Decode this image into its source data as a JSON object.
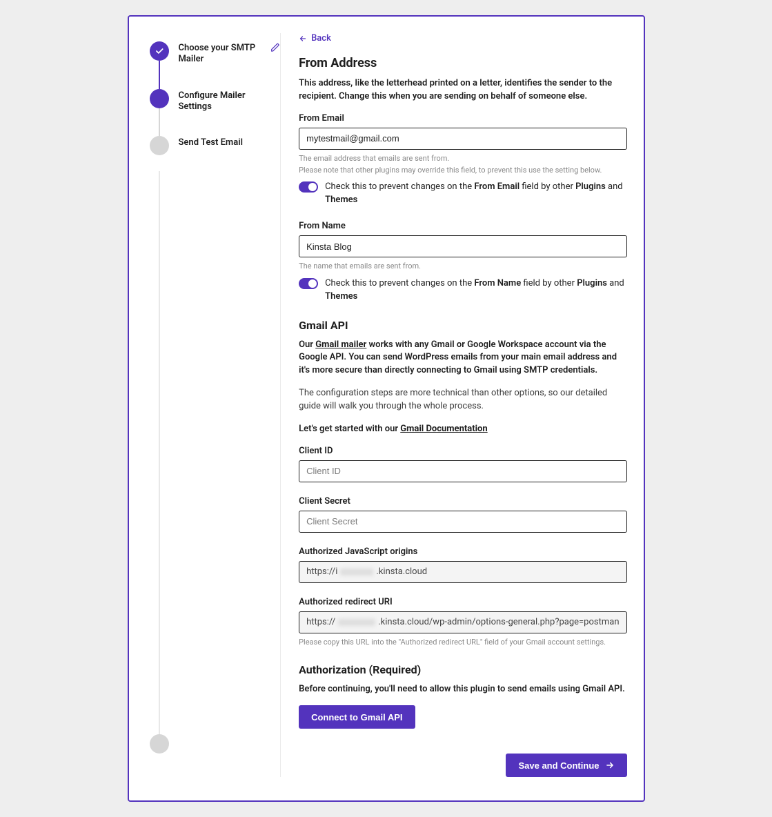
{
  "stepper": {
    "step1": "Choose your SMTP Mailer",
    "step2": "Configure Mailer Settings",
    "step3": "Send Test Email"
  },
  "back_label": "Back",
  "from_address": {
    "heading": "From Address",
    "description": "This address, like the letterhead printed on a letter, identifies the sender to the recipient. Change this when you are sending on behalf of someone else.",
    "email_label": "From Email",
    "email_value": "mytestmail@gmail.com",
    "email_help1": "The email address that emails are sent from.",
    "email_help2": "Please note that other plugins may override this field, to prevent this use the setting below.",
    "email_toggle_prefix": "Check this to prevent changes on the ",
    "email_toggle_bold1": "From Email",
    "email_toggle_mid": " field by other ",
    "email_toggle_bold2": "Plugins",
    "email_toggle_and": " and ",
    "email_toggle_bold3": "Themes",
    "name_label": "From Name",
    "name_value": "Kinsta Blog",
    "name_help": "The name that emails are sent from.",
    "name_toggle_prefix": "Check this to prevent changes on the ",
    "name_toggle_bold1": "From Name",
    "name_toggle_mid": " field by other ",
    "name_toggle_bold2": "Plugins",
    "name_toggle_and": " and ",
    "name_toggle_bold3": "Themes"
  },
  "gmail_api": {
    "heading": "Gmail API",
    "p1_prefix": "Our ",
    "p1_link": "Gmail mailer",
    "p1_suffix": " works with any Gmail or Google Workspace account via the Google API. You can send WordPress emails from your main email address and it's more secure than directly connecting to Gmail using SMTP credentials.",
    "p2": "The configuration steps are more technical than other options, so our detailed guide will walk you through the whole process.",
    "p3_prefix": "Let's get started with our ",
    "p3_link": "Gmail Documentation",
    "client_id_label": "Client ID",
    "client_id_placeholder": "Client ID",
    "client_secret_label": "Client Secret",
    "client_secret_placeholder": "Client Secret",
    "js_origins_label": "Authorized JavaScript origins",
    "js_origins_prefix": "https://i",
    "js_origins_suffix": ".kinsta.cloud",
    "redirect_label": "Authorized redirect URI",
    "redirect_prefix": "https://",
    "redirect_suffix": ".kinsta.cloud/wp-admin/options-general.php?page=postman",
    "redirect_help": "Please copy this URL into the \"Authorized redirect URL\" field of your Gmail account settings."
  },
  "authorization": {
    "heading": "Authorization (Required)",
    "description": "Before continuing, you'll need to allow this plugin to send emails using Gmail API.",
    "connect_button": "Connect to Gmail API"
  },
  "save_button": "Save and Continue"
}
